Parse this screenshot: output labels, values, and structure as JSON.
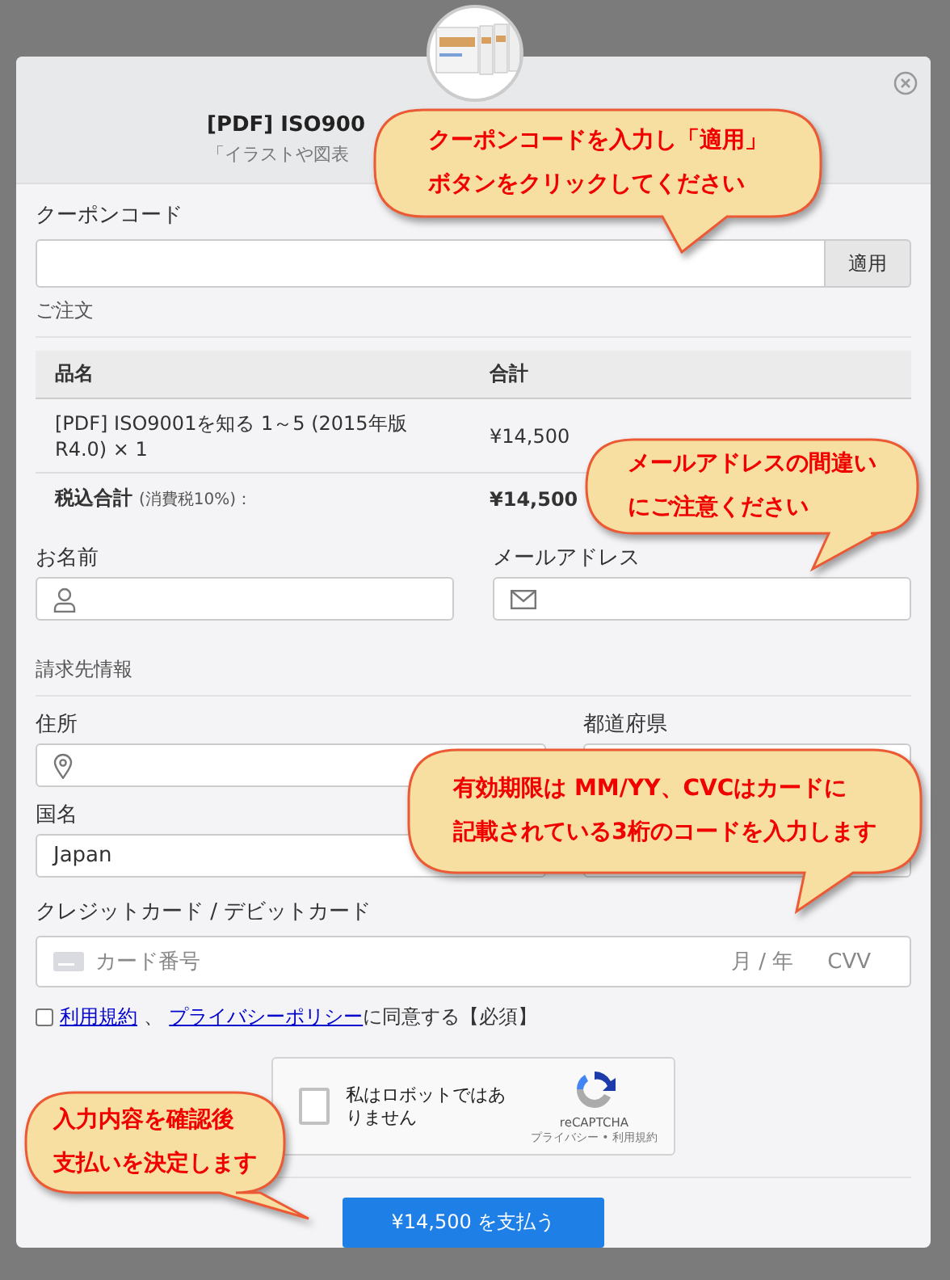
{
  "header": {
    "title": "[PDF] ISO900",
    "subtitle": "「イラストや図表"
  },
  "coupon": {
    "label": "クーポンコード",
    "button": "適用"
  },
  "order": {
    "heading": "ご注文",
    "columns": [
      "品名",
      "合計"
    ],
    "rows": [
      {
        "name": "[PDF] ISO9001を知る 1～5 (2015年版 R4.0) × 1",
        "total": "¥14,500"
      }
    ],
    "total_label": "税込合計",
    "tax_note": "(消費税10%)：",
    "total": "¥14,500"
  },
  "contact": [
    {
      "label": "お名前",
      "kind": "person"
    },
    {
      "label": "メールアドレス",
      "kind": "mail"
    }
  ],
  "billing": {
    "heading": "請求先情報",
    "rows": [
      [
        {
          "label": "住所",
          "kind": "pin"
        },
        {
          "label": "都道府県",
          "kind": "plain"
        }
      ],
      [
        {
          "label": "国名",
          "kind": "plain",
          "value": "Japan"
        },
        {
          "kind": "plain"
        }
      ]
    ]
  },
  "card": {
    "label": "クレジットカード / デビットカード",
    "placeholder": "カード番号",
    "expiry": "月 / 年",
    "cvv": "CVV"
  },
  "agreement": {
    "checked": false,
    "links": [
      "利用規約",
      "プライバシーポリシー"
    ],
    "separator": "、",
    "text": "に同意する【必須】"
  },
  "captcha": {
    "checked": false,
    "label": "私はロボットではありません",
    "brand": "reCAPTCHA",
    "links": "プライバシー • 利用規約"
  },
  "pay_button": "¥14,500 を支払う",
  "callouts": [
    {
      "lines": [
        "クーポンコードを入力し「適用」",
        "ボタンをクリックしてください"
      ]
    },
    {
      "lines": [
        "メールアドレスの間違い",
        "にご注意ください"
      ]
    },
    {
      "lines": [
        "有効期限は MM/YY、CVCはカードに",
        "記載されている3桁のコードを入力します"
      ]
    },
    {
      "lines": [
        "入力内容を確認後",
        "支払いを決定します"
      ]
    }
  ]
}
